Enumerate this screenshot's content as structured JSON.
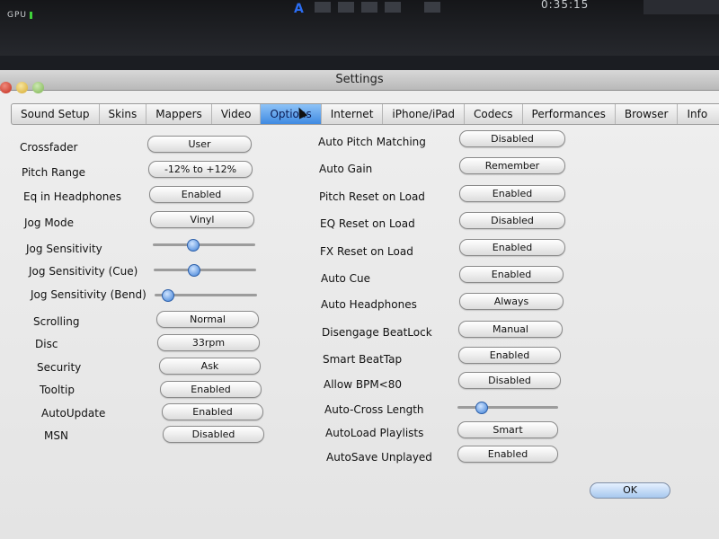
{
  "desktop": {
    "gpu_label": "GPU",
    "app_letter": "A",
    "clock": "0:35:15"
  },
  "window": {
    "title": "Settings"
  },
  "tabs": [
    {
      "label": "Sound Setup",
      "active": false
    },
    {
      "label": "Skins",
      "active": false
    },
    {
      "label": "Mappers",
      "active": false
    },
    {
      "label": "Video",
      "active": false
    },
    {
      "label": "Options",
      "active": true
    },
    {
      "label": "Internet",
      "active": false
    },
    {
      "label": "iPhone/iPad",
      "active": false
    },
    {
      "label": "Codecs",
      "active": false
    },
    {
      "label": "Performances",
      "active": false
    },
    {
      "label": "Browser",
      "active": false
    },
    {
      "label": "Info",
      "active": false
    }
  ],
  "left_settings": {
    "crossfader": {
      "label": "Crossfader",
      "value": "User"
    },
    "pitch_range": {
      "label": "Pitch Range",
      "value": "-12% to +12%"
    },
    "eq_in_headphones": {
      "label": "Eq in Headphones",
      "value": "Enabled"
    },
    "jog_mode": {
      "label": "Jog Mode",
      "value": "Vinyl"
    },
    "jog_sensitivity": {
      "label": "Jog Sensitivity",
      "level": 0.38
    },
    "jog_sensitivity_cue": {
      "label": "Jog Sensitivity (Cue)",
      "level": 0.38
    },
    "jog_sensitivity_bend": {
      "label": "Jog Sensitivity (Bend)",
      "level": 0.08
    },
    "scrolling": {
      "label": "Scrolling",
      "value": "Normal"
    },
    "disc": {
      "label": "Disc",
      "value": "33rpm"
    },
    "security": {
      "label": "Security",
      "value": "Ask"
    },
    "tooltip": {
      "label": "Tooltip",
      "value": "Enabled"
    },
    "autoupdate": {
      "label": "AutoUpdate",
      "value": "Enabled"
    },
    "msn": {
      "label": "MSN",
      "value": "Disabled"
    }
  },
  "right_settings": {
    "auto_pitch_matching": {
      "label": "Auto Pitch Matching",
      "value": "Disabled"
    },
    "auto_gain": {
      "label": "Auto Gain",
      "value": "Remember"
    },
    "pitch_reset_on_load": {
      "label": "Pitch Reset on Load",
      "value": "Enabled"
    },
    "eq_reset_on_load": {
      "label": "EQ Reset on Load",
      "value": "Disabled"
    },
    "fx_reset_on_load": {
      "label": "FX Reset on Load",
      "value": "Enabled"
    },
    "auto_cue": {
      "label": "Auto Cue",
      "value": "Enabled"
    },
    "auto_headphones": {
      "label": "Auto Headphones",
      "value": "Always"
    },
    "disengage_beatlock": {
      "label": "Disengage BeatLock",
      "value": "Manual"
    },
    "smart_beattap": {
      "label": "Smart BeatTap",
      "value": "Enabled"
    },
    "allow_bpm": {
      "label": "Allow BPM<80",
      "value": "Disabled"
    },
    "auto_cross_length": {
      "label": "Auto-Cross Length",
      "level": 0.2
    },
    "autoload_playlists": {
      "label": "AutoLoad Playlists",
      "value": "Smart"
    },
    "autosave_unplayed": {
      "label": "AutoSave Unplayed",
      "value": "Enabled"
    }
  },
  "ok_label": "OK",
  "colors": {
    "accent": "#3f8ae2",
    "window_bg": "#e8e8e8"
  }
}
